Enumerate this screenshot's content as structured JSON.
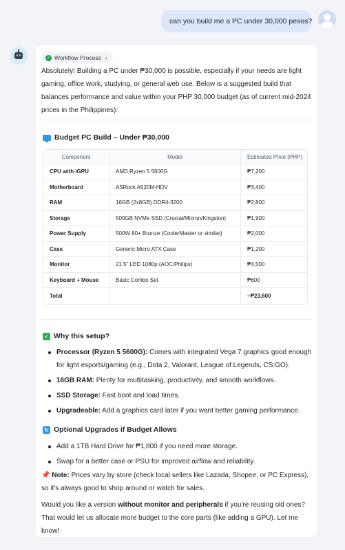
{
  "user_message": "can you build me a PC under 30,000 pesos?",
  "workflow_label": "Workflow Process",
  "intro": "Absolutely! Building a PC under ₱30,000 is possible, especially if your needs are light gaming, office work, studying, or general web use. Below is a suggested build that balances performance and value within your PHP 30,000 budget (as of current mid-2024 prices in the Philippines):",
  "build_heading": "Budget PC Build – Under ₱30,000",
  "table": {
    "headers": [
      "Component",
      "Model",
      "Estimated Price (PHP)"
    ],
    "rows": [
      [
        "CPU with iGPU",
        "AMD Ryzen 5 5600G",
        "₱7,200"
      ],
      [
        "Motherboard",
        "ASRock A520M-HDV",
        "₱3,400"
      ],
      [
        "RAM",
        "16GB (2x8GB) DDR4-3200",
        "₱2,800"
      ],
      [
        "Storage",
        "500GB NVMe SSD (Crucial/Micron/Kingston)",
        "₱1,900"
      ],
      [
        "Power Supply",
        "500W 80+ Bronze (CoolerMaster or similar)",
        "₱2,000"
      ],
      [
        "Case",
        "Generic Micro ATX Case",
        "₱1,200"
      ],
      [
        "Monitor",
        "21.5\" LED 1080p (AOC/Philips)",
        "₱4,500"
      ],
      [
        "Keyboard + Mouse",
        "Basic Combo Set",
        "₱600"
      ],
      [
        "Total",
        "",
        "~₱23,600"
      ]
    ]
  },
  "why_heading": "Why this setup?",
  "why_items": [
    {
      "bold": "Processor (Ryzen 5 5600G):",
      "text": " Comes with integrated Vega 7 graphics good enough for light esports/gaming (e.g., Dota 2, Valorant, League of Legends, CS:GO)."
    },
    {
      "bold": "16GB RAM:",
      "text": " Plenty for multitasking, productivity, and smooth workflows."
    },
    {
      "bold": "SSD Storage:",
      "text": " Fast boot and load times."
    },
    {
      "bold": "Upgradeable:",
      "text": " Add a graphics card later if you want better gaming performance."
    }
  ],
  "optional_heading": "Optional Upgrades if Budget Allows",
  "optional_items": [
    "Add a 1TB Hard Drive for ₱1,800 if you need more storage.",
    "Swap for a better case or PSU for improved airflow and reliability."
  ],
  "note": {
    "bold": "Note:",
    "text": " Prices vary by store (check local sellers like Lazada, Shopee, or PC Express), so it's always good to shop around or watch for sales."
  },
  "closing": {
    "pre": "Would you like a version ",
    "bold": "without monitor and peripherals",
    "post": " if you're reusing old ones? That would let us allocate more budget to the core parts (like adding a GPU). Let me know!"
  },
  "colors": {
    "user_bubble": "#dde7fb",
    "check_green": "#22a447",
    "accent_blue": "#2f9be8",
    "pin_red": "#e03b3b"
  }
}
